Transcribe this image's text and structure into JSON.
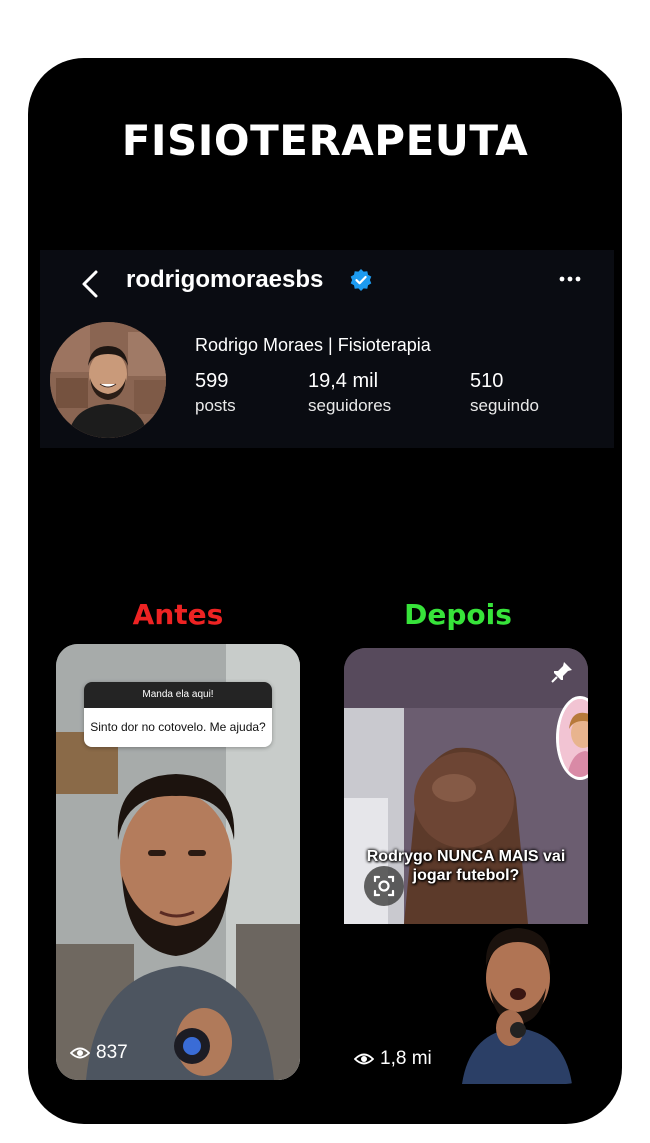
{
  "headline": "FISIOTERAPEUTA",
  "profile": {
    "username": "rodrigomoraesbs",
    "display_name": "Rodrigo Moraes | Fisioterapia",
    "stats": [
      {
        "value": "599",
        "label": "posts"
      },
      {
        "value": "19,4 mil",
        "label": "seguidores"
      },
      {
        "value": "510",
        "label": "seguindo"
      }
    ]
  },
  "compare": {
    "before_label": "Antes",
    "after_label": "Depois",
    "before_color": "#ee2323",
    "after_color": "#37e33a"
  },
  "before_card": {
    "question_header": "Manda ela aqui!",
    "question_text": "Sinto dor no cotovelo. Me ajuda?",
    "views": "837"
  },
  "after_card": {
    "caption_line1": "Rodrygo NUNCA MAIS vai",
    "caption_line2": "jogar futebol?",
    "views": "1,8 mi"
  },
  "icons": [
    "back-arrow-icon",
    "verified-badge-icon",
    "more-options-icon",
    "eye-icon",
    "pin-icon",
    "visual-search-icon"
  ],
  "colors": {
    "verified": "#1d9bf0",
    "background": "#000000"
  }
}
